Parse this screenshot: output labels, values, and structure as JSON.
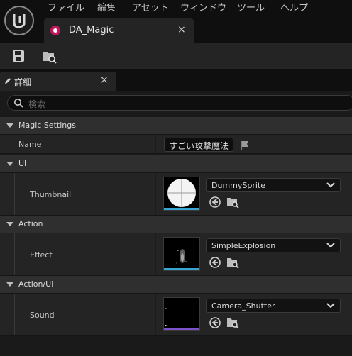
{
  "menu": [
    "ファイル",
    "編集",
    "アセット",
    "ウィンドウ",
    "ツール",
    "ヘルプ"
  ],
  "asset_tab": {
    "title": "DA_Magic",
    "close": "×"
  },
  "details_tab": {
    "title": "詳細",
    "close": "×"
  },
  "search": {
    "placeholder": "検索"
  },
  "categories": {
    "magic_settings": "Magic Settings",
    "ui": "UI",
    "action": "Action",
    "action_ui": "Action/UI"
  },
  "properties": {
    "name": {
      "label": "Name",
      "value": "すごい攻撃魔法"
    },
    "thumbnail": {
      "label": "Thumbnail",
      "value": "DummySprite"
    },
    "effect": {
      "label": "Effect",
      "value": "SimpleExplosion"
    },
    "sound": {
      "label": "Sound",
      "value": "Camera_Shutter"
    }
  },
  "colors": {
    "asset_dot": "#c2185b",
    "texture_bar": "#37a6d4",
    "sound_bar": "#7b52c9"
  },
  "icons": [
    "ue-logo-icon",
    "save-icon",
    "browse-icon",
    "edit-icon",
    "search-icon",
    "flag-icon",
    "use-selected-icon",
    "browse-folder-icon",
    "chevron-down-icon"
  ]
}
